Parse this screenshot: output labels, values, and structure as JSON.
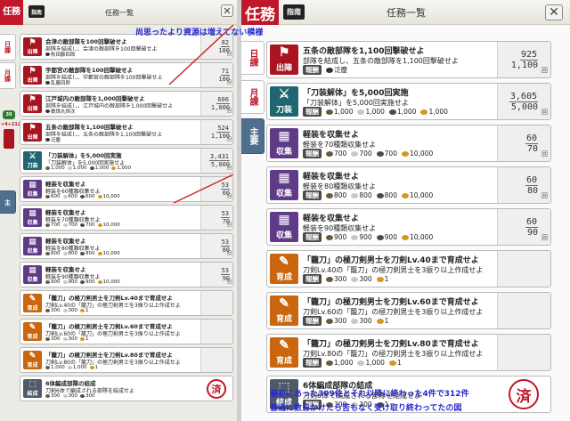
{
  "left": {
    "brand": "任務",
    "guide": "指南",
    "title": "任務一覧",
    "tabs": [
      "日課",
      "月課",
      "主"
    ],
    "badge": "30",
    "side_num": "+4+212",
    "quests": [
      {
        "icon": "sortie",
        "cat": "出陣",
        "color": "c-red",
        "name": "会津の敵部隊を100回撃破せよ",
        "desc": "部隊を結成し、会津の敵部隊を100回撃破せよ",
        "rewards": [
          {
            "type": "item",
            "name": "秋田藤四郎"
          }
        ],
        "progress": {
          "cur": "82",
          "max": "100"
        }
      },
      {
        "icon": "sortie",
        "cat": "出陣",
        "color": "c-red",
        "name": "宇都宮の敵部隊を100回撃破せよ",
        "desc": "部隊を結成し、宇都宮の敵部隊を100回撃破せよ",
        "rewards": [
          {
            "type": "item",
            "name": "乱藤四郎"
          }
        ],
        "progress": {
          "cur": "71",
          "max": "100"
        }
      },
      {
        "icon": "sortie",
        "cat": "出陣",
        "color": "c-red",
        "name": "江戸城内の敵部隊を1,000回撃破せよ",
        "desc": "部隊を結成し、江戸城内の敵部隊を1,000回撃破せよ",
        "rewards": [
          {
            "type": "item",
            "name": "数珠丸恒次"
          }
        ],
        "progress": {
          "cur": "606",
          "max": "1,000"
        }
      },
      {
        "icon": "sortie",
        "cat": "出陣",
        "color": "c-red",
        "name": "五条の敵部隊を1,100回撃破せよ",
        "desc": "部隊を結成し、五条の敵部隊を1,100回撃破せよ",
        "rewards": [
          {
            "type": "item",
            "name": "泛塵"
          }
        ],
        "progress": {
          "cur": "524",
          "max": "1,100"
        }
      },
      {
        "icon": "sword",
        "cat": "刀装",
        "color": "c-teal",
        "name": "「刀装解体」を5,000回実施",
        "desc": "「刀装解体」を5,000回実施せよ",
        "rewards": [
          {
            "type": "res",
            "c": "#6a5a3a",
            "v": "1,000"
          },
          {
            "type": "res",
            "c": "#c8c8c8",
            "v": "1,000"
          },
          {
            "type": "res",
            "c": "#4a4a4a",
            "v": "1,000"
          },
          {
            "type": "res",
            "c": "#d09a20",
            "v": "1,000"
          }
        ],
        "progress": {
          "cur": "3,431",
          "max": "5,000"
        }
      },
      {
        "icon": "collect",
        "cat": "収集",
        "color": "c-purple",
        "name": "軽装を収集せよ",
        "desc": "軽装を60種類収集せよ",
        "rewards": [
          {
            "type": "res",
            "c": "#6a5a3a",
            "v": "600"
          },
          {
            "type": "res",
            "c": "#c8c8c8",
            "v": "600"
          },
          {
            "type": "res",
            "c": "#4a4a4a",
            "v": "600"
          },
          {
            "type": "res",
            "c": "#d09a20",
            "v": "10,000"
          }
        ],
        "progress": {
          "cur": "53",
          "max": "60"
        }
      },
      {
        "icon": "collect",
        "cat": "収集",
        "color": "c-purple",
        "name": "軽装を収集せよ",
        "desc": "軽装を70種類収集せよ",
        "rewards": [
          {
            "type": "res",
            "c": "#6a5a3a",
            "v": "700"
          },
          {
            "type": "res",
            "c": "#c8c8c8",
            "v": "700"
          },
          {
            "type": "res",
            "c": "#4a4a4a",
            "v": "700"
          },
          {
            "type": "res",
            "c": "#d09a20",
            "v": "10,000"
          }
        ],
        "progress": {
          "cur": "53",
          "max": "70"
        }
      },
      {
        "icon": "collect",
        "cat": "収集",
        "color": "c-purple",
        "name": "軽装を収集せよ",
        "desc": "軽装を80種類収集せよ",
        "rewards": [
          {
            "type": "res",
            "c": "#6a5a3a",
            "v": "800"
          },
          {
            "type": "res",
            "c": "#c8c8c8",
            "v": "800"
          },
          {
            "type": "res",
            "c": "#4a4a4a",
            "v": "800"
          },
          {
            "type": "res",
            "c": "#d09a20",
            "v": "10,000"
          }
        ],
        "progress": {
          "cur": "53",
          "max": "80"
        }
      },
      {
        "icon": "collect",
        "cat": "収集",
        "color": "c-purple",
        "name": "軽装を収集せよ",
        "desc": "軽装を90種類収集せよ",
        "rewards": [
          {
            "type": "res",
            "c": "#6a5a3a",
            "v": "900"
          },
          {
            "type": "res",
            "c": "#c8c8c8",
            "v": "900"
          },
          {
            "type": "res",
            "c": "#4a4a4a",
            "v": "900"
          },
          {
            "type": "res",
            "c": "#d09a20",
            "v": "10,000"
          }
        ],
        "progress": {
          "cur": "53",
          "max": "90"
        }
      },
      {
        "icon": "train",
        "cat": "育成",
        "color": "c-orange",
        "name": "「籠刀」の極刀剣男士を刀剣Lv.40まで育成せよ",
        "desc": "刀剣Lv.40の「籠刀」の極刀剣男士を3振り以上作成せよ",
        "rewards": [
          {
            "type": "res",
            "c": "#6a5a3a",
            "v": "300"
          },
          {
            "type": "res",
            "c": "#c8c8c8",
            "v": "300"
          },
          {
            "type": "res",
            "c": "#d09a20",
            "v": "1"
          }
        ],
        "progress": null
      },
      {
        "icon": "train",
        "cat": "育成",
        "color": "c-orange",
        "name": "「籠刀」の極刀剣男士を刀剣Lv.60まで育成せよ",
        "desc": "刀剣Lv.60の「籠刀」の極刀剣男士を3振り以上作成せよ",
        "rewards": [
          {
            "type": "res",
            "c": "#6a5a3a",
            "v": "300"
          },
          {
            "type": "res",
            "c": "#c8c8c8",
            "v": "300"
          },
          {
            "type": "res",
            "c": "#d09a20",
            "v": "1"
          }
        ],
        "progress": null
      },
      {
        "icon": "train",
        "cat": "育成",
        "color": "c-orange",
        "name": "「籠刀」の極刀剣男士を刀剣Lv.80まで育成せよ",
        "desc": "刀剣Lv.80の「籠刀」の極刀剣男士を3振り以上作成せよ",
        "rewards": [
          {
            "type": "res",
            "c": "#6a5a3a",
            "v": "1,000"
          },
          {
            "type": "res",
            "c": "#c8c8c8",
            "v": "1,000"
          },
          {
            "type": "res",
            "c": "#d09a20",
            "v": "1"
          }
        ],
        "progress": null
      },
      {
        "icon": "form",
        "cat": "結成",
        "color": "c-slate",
        "name": "6体編成部隊の結成",
        "desc": "刀剣6体で編成される部隊を結成せよ",
        "rewards": [
          {
            "type": "res",
            "c": "#6a5a3a",
            "v": "300"
          },
          {
            "type": "res",
            "c": "#c8c8c8",
            "v": "300"
          },
          {
            "type": "res",
            "c": "#4a4a4a",
            "v": "300"
          }
        ],
        "progress": null,
        "done": "済"
      }
    ]
  },
  "right": {
    "brand": "任務",
    "guide": "指南",
    "title": "任務一覧",
    "tabs": [
      "日課",
      "月課",
      "主要"
    ],
    "reward_label": "報酬",
    "unit": "回",
    "quests": [
      {
        "icon": "sortie",
        "cat": "出陣",
        "color": "c-red",
        "name": "五条の敵部隊を1,100回撃破せよ",
        "desc": "部隊を結成し、五条の敵部隊を1,100回撃破せよ",
        "rewards": [
          {
            "type": "item",
            "name": "泛塵"
          }
        ],
        "progress": {
          "cur": "925",
          "max": "1,100"
        }
      },
      {
        "icon": "sword",
        "cat": "刀装",
        "color": "c-teal",
        "name": "「刀装解体」を5,000回実施",
        "desc": "「刀装解体」を5,000回実施せよ",
        "rewards": [
          {
            "type": "res",
            "c": "#6a5a3a",
            "v": "1,000"
          },
          {
            "type": "res",
            "c": "#c8c8c8",
            "v": "1,000"
          },
          {
            "type": "res",
            "c": "#4a4a4a",
            "v": "1,000"
          },
          {
            "type": "res",
            "c": "#d09a20",
            "v": "1,000"
          }
        ],
        "progress": {
          "cur": "3,605",
          "max": "5,000"
        }
      },
      {
        "icon": "collect",
        "cat": "収集",
        "color": "c-purple",
        "name": "軽装を収集せよ",
        "desc": "軽装を70種類収集せよ",
        "rewards": [
          {
            "type": "res",
            "c": "#6a5a3a",
            "v": "700"
          },
          {
            "type": "res",
            "c": "#c8c8c8",
            "v": "700"
          },
          {
            "type": "res",
            "c": "#4a4a4a",
            "v": "700"
          },
          {
            "type": "res",
            "c": "#d09a20",
            "v": "10,000"
          }
        ],
        "progress": {
          "cur": "60",
          "max": "70"
        }
      },
      {
        "icon": "collect",
        "cat": "収集",
        "color": "c-purple",
        "name": "軽装を収集せよ",
        "desc": "軽装を80種類収集せよ",
        "rewards": [
          {
            "type": "res",
            "c": "#6a5a3a",
            "v": "800"
          },
          {
            "type": "res",
            "c": "#c8c8c8",
            "v": "800"
          },
          {
            "type": "res",
            "c": "#4a4a4a",
            "v": "800"
          },
          {
            "type": "res",
            "c": "#d09a20",
            "v": "10,000"
          }
        ],
        "progress": {
          "cur": "60",
          "max": "80"
        }
      },
      {
        "icon": "collect",
        "cat": "収集",
        "color": "c-purple",
        "name": "軽装を収集せよ",
        "desc": "軽装を90種類収集せよ",
        "rewards": [
          {
            "type": "res",
            "c": "#6a5a3a",
            "v": "900"
          },
          {
            "type": "res",
            "c": "#c8c8c8",
            "v": "900"
          },
          {
            "type": "res",
            "c": "#4a4a4a",
            "v": "900"
          },
          {
            "type": "res",
            "c": "#d09a20",
            "v": "10,000"
          }
        ],
        "progress": {
          "cur": "60",
          "max": "90"
        }
      },
      {
        "icon": "train",
        "cat": "育成",
        "color": "c-orange",
        "name": "「籠刀」の極刀剣男士を刀剣Lv.40まで育成せよ",
        "desc": "刀剣Lv.40の「籠刀」の極刀剣男士を3振り以上作成せよ",
        "rewards": [
          {
            "type": "res",
            "c": "#6a5a3a",
            "v": "300"
          },
          {
            "type": "res",
            "c": "#c8c8c8",
            "v": "300"
          },
          {
            "type": "res",
            "c": "#d09a20",
            "v": "1"
          }
        ],
        "progress": null
      },
      {
        "icon": "train",
        "cat": "育成",
        "color": "c-orange",
        "name": "「籠刀」の極刀剣男士を刀剣Lv.60まで育成せよ",
        "desc": "刀剣Lv.60の「籠刀」の極刀剣男士を3振り以上作成せよ",
        "rewards": [
          {
            "type": "res",
            "c": "#6a5a3a",
            "v": "300"
          },
          {
            "type": "res",
            "c": "#c8c8c8",
            "v": "300"
          },
          {
            "type": "res",
            "c": "#d09a20",
            "v": "1"
          }
        ],
        "progress": null
      },
      {
        "icon": "train",
        "cat": "育成",
        "color": "c-orange",
        "name": "「籠刀」の極刀剣男士を刀剣Lv.80まで育成せよ",
        "desc": "刀剣Lv.80の「籠刀」の極刀剣男士を3振り以上作成せよ",
        "rewards": [
          {
            "type": "res",
            "c": "#6a5a3a",
            "v": "1,000"
          },
          {
            "type": "res",
            "c": "#c8c8c8",
            "v": "1,000"
          },
          {
            "type": "res",
            "c": "#d09a20",
            "v": "1"
          }
        ],
        "progress": null
      },
      {
        "icon": "form",
        "cat": "結成",
        "color": "c-slate",
        "name": "6体編成部隊の結成",
        "desc": "刀剣6体で編成される部隊を結成せよ",
        "rewards": [
          {
            "type": "res",
            "c": "#6a5a3a",
            "v": "300"
          },
          {
            "type": "res",
            "c": "#c8c8c8",
            "v": "300"
          },
          {
            "type": "res",
            "c": "#4a4a4a",
            "v": "1"
          }
        ],
        "progress": null,
        "done": "済"
      }
    ]
  },
  "annotations": {
    "top": "尚思ったより資源は増えてない模様",
    "bottom1": "最初にあった309件とそれ以降に終わった4件で312件",
    "bottom2": "普通に数日かけたら苦もなく受け取り終わってたの図"
  },
  "icons": {
    "close": "close-icon",
    "sortie": "sortie-icon",
    "sword": "sword-icon",
    "collect": "collect-icon",
    "train": "train-icon",
    "form": "form-icon"
  },
  "colors": {
    "brand": "#c0182a",
    "annotation": "#2a2ad0",
    "tab_active": "#4f6f8f"
  }
}
